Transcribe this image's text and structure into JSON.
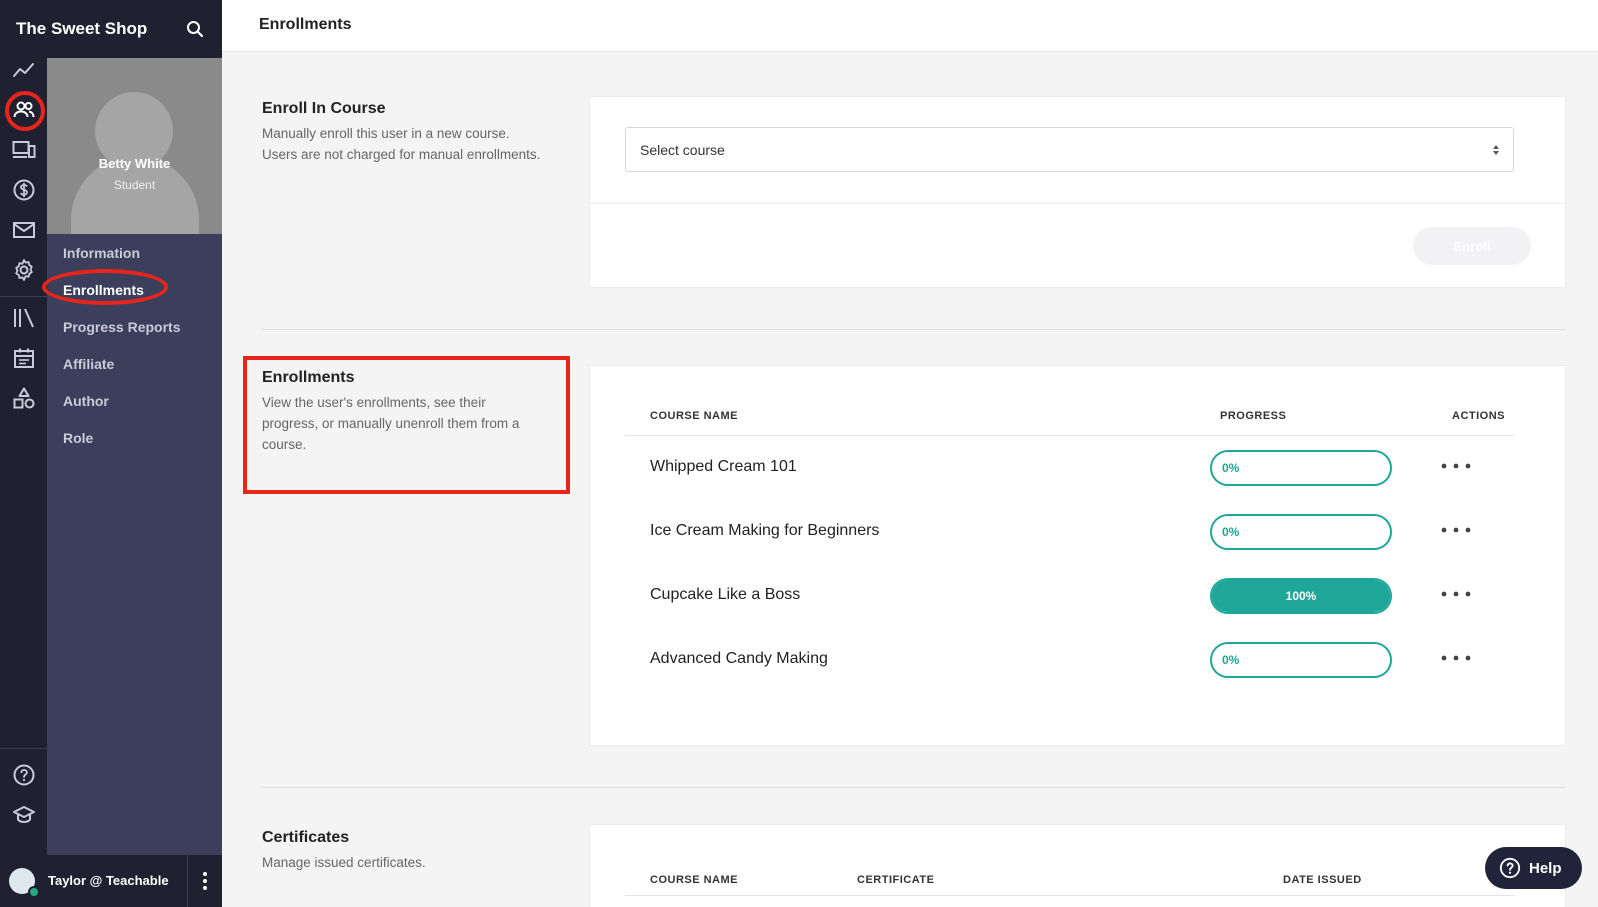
{
  "brand": {
    "title": "The Sweet Shop"
  },
  "rail": {
    "icons": [
      "analytics-icon",
      "users-icon",
      "devices-icon",
      "dollar-icon",
      "mail-icon",
      "gear-icon",
      "library-icon",
      "calendar-icon",
      "shapes-icon",
      "help-circle-icon",
      "graduation-cap-icon"
    ]
  },
  "profile": {
    "name": "Betty White",
    "role": "Student"
  },
  "subnav": {
    "items": [
      "Information",
      "Enrollments",
      "Progress Reports",
      "Affiliate",
      "Author",
      "Role"
    ],
    "active": "Enrollments"
  },
  "user": {
    "name": "Taylor @ Teachable"
  },
  "header": {
    "title": "Enrollments"
  },
  "enroll_section": {
    "title": "Enroll In Course",
    "desc_line1": "Manually enroll this user in a new course.",
    "desc_line2": "Users are not charged for manual enrollments.",
    "select_label": "Select course",
    "button_label": "Enroll"
  },
  "enrollments_section": {
    "title": "Enrollments",
    "desc_line1": "View the user's enrollments, see their",
    "desc_line2": "progress, or manually unenroll them from a",
    "desc_line3": "course.",
    "columns": {
      "course": "COURSE NAME",
      "progress": "PROGRESS",
      "actions": "ACTIONS"
    },
    "rows": [
      {
        "course": "Whipped Cream 101",
        "progress_label": "0%",
        "progress": 0
      },
      {
        "course": "Ice Cream Making for Beginners",
        "progress_label": "0%",
        "progress": 0
      },
      {
        "course": "Cupcake Like a Boss",
        "progress_label": "100%",
        "progress": 100
      },
      {
        "course": "Advanced Candy Making",
        "progress_label": "0%",
        "progress": 0
      }
    ]
  },
  "certificates_section": {
    "title": "Certificates",
    "desc": "Manage issued certificates.",
    "columns": {
      "course": "COURSE NAME",
      "certificate": "CERTIFICATE",
      "date": "DATE ISSUED"
    }
  },
  "help": {
    "label": "Help"
  },
  "colors": {
    "accent": "#1ea799",
    "sidebar": "#1f2130",
    "subbar": "#3b3f5c",
    "annotation": "#e8241b"
  }
}
